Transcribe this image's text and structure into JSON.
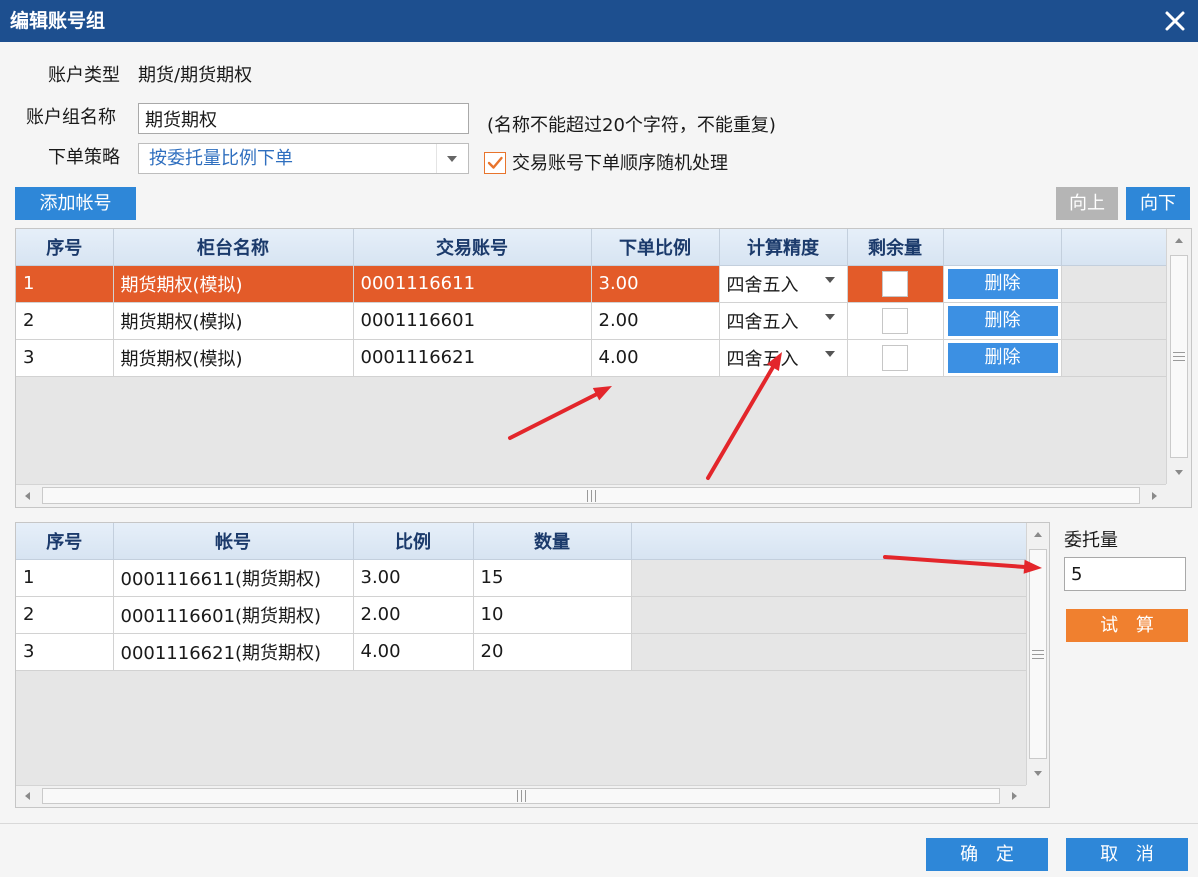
{
  "window": {
    "title": "编辑账号组"
  },
  "form": {
    "account_type_label": "账户类型",
    "account_type_value": "期货/期货期权",
    "group_name_label": "账户组名称",
    "group_name_value": "期货期权",
    "group_name_hint": "(名称不能超过20个字符，不能重复)",
    "strategy_label": "下单策略",
    "strategy_value": "按委托量比例下单",
    "random_order_checked": true,
    "random_order_label": "交易账号下单顺序随机处理"
  },
  "toolbar": {
    "add_account": "添加帐号",
    "move_up": "向上",
    "move_down": "向下"
  },
  "accounts_table": {
    "columns": [
      "序号",
      "柜台名称",
      "交易账号",
      "下单比例",
      "计算精度",
      "剩余量"
    ],
    "rows": [
      {
        "index": "1",
        "counter": "期货期权(模拟)",
        "account": "0001116611",
        "ratio": "3.00",
        "precision": "四舍五入",
        "remaining_checked": false,
        "delete_label": "删除",
        "selected": true
      },
      {
        "index": "2",
        "counter": "期货期权(模拟)",
        "account": "0001116601",
        "ratio": "2.00",
        "precision": "四舍五入",
        "remaining_checked": false,
        "delete_label": "删除",
        "selected": false
      },
      {
        "index": "3",
        "counter": "期货期权(模拟)",
        "account": "0001116621",
        "ratio": "4.00",
        "precision": "四舍五入",
        "remaining_checked": false,
        "delete_label": "删除",
        "selected": false
      }
    ]
  },
  "allocation_table": {
    "columns": [
      "序号",
      "帐号",
      "比例",
      "数量"
    ],
    "rows": [
      {
        "index": "1",
        "account": "0001116611(期货期权)",
        "ratio": "3.00",
        "quantity": "15"
      },
      {
        "index": "2",
        "account": "0001116601(期货期权)",
        "ratio": "2.00",
        "quantity": "10"
      },
      {
        "index": "3",
        "account": "0001116621(期货期权)",
        "ratio": "4.00",
        "quantity": "20"
      }
    ]
  },
  "trial": {
    "quantity_label": "委托量",
    "quantity_value": "5",
    "calc_button": "试 算"
  },
  "footer": {
    "ok": "确 定",
    "cancel": "取 消"
  },
  "icons": {
    "close": "close-icon",
    "dropdown": "chevron-down-icon",
    "check": "checkmark-icon",
    "scroll_up": "arrow-up-icon",
    "scroll_down": "arrow-down-icon",
    "scroll_left": "arrow-left-icon",
    "scroll_right": "arrow-right-icon",
    "grip": "grip-icon",
    "annotation": "red-arrow-annotation"
  },
  "colors": {
    "title_bar": "#1d4f8f",
    "accent": "#2e87d8",
    "delete_button": "#3c90e3",
    "selected_row": "#e35b29",
    "orange_button": "#f0802f",
    "header_text": "#1b3a6b",
    "check": "#e8742c",
    "strategy_text": "#2f6fbf",
    "disabled_button": "#b5b5b5",
    "annotation": "#e3262b"
  }
}
